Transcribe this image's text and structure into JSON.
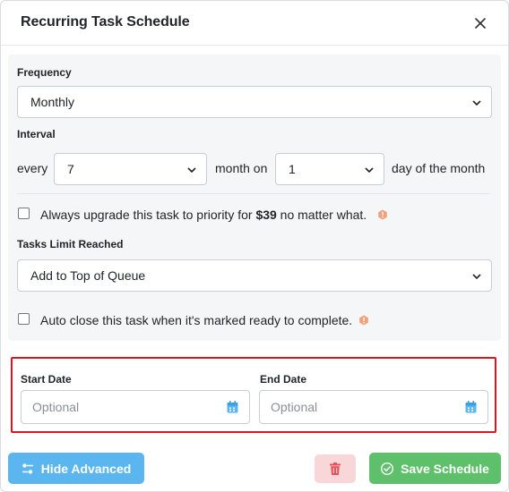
{
  "modal": {
    "title": "Recurring Task Schedule",
    "close_icon": "close-icon"
  },
  "frequency": {
    "label": "Frequency",
    "value": "Monthly"
  },
  "interval": {
    "label": "Interval",
    "prefix": "every",
    "count_value": "7",
    "middle": "month on",
    "day_value": "1",
    "suffix": "day of the month"
  },
  "upgrade_option": {
    "checked": false,
    "text_before": "Always upgrade this task to priority for ",
    "price": "$39",
    "text_after": " no matter what.",
    "info_icon": "warning-hex-icon"
  },
  "tasks_limit": {
    "label": "Tasks Limit Reached",
    "value": "Add to Top of Queue"
  },
  "auto_close_option": {
    "checked": false,
    "text": "Auto close this task when it's marked ready to complete.",
    "info_icon": "warning-hex-icon"
  },
  "dates": {
    "start_label": "Start Date",
    "start_placeholder": "Optional",
    "end_label": "End Date",
    "end_placeholder": "Optional",
    "calendar_icon": "calendar-icon"
  },
  "footer": {
    "hide_label": "Hide Advanced",
    "delete_icon": "trash-icon",
    "save_label": "Save Schedule"
  },
  "colors": {
    "highlight_border": "#e0141c",
    "primary_button": "#5bb6f0",
    "success_button": "#5ec06b",
    "danger_button_bg": "#f9d7d9",
    "danger_icon": "#e8505b",
    "warning_icon": "#f0a07a"
  }
}
